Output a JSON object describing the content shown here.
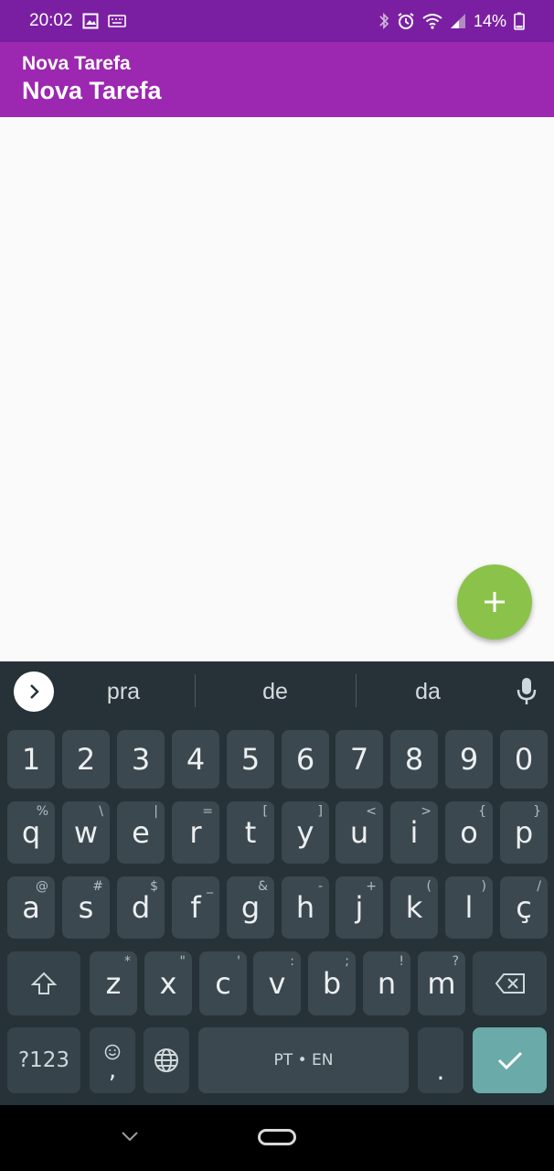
{
  "status_bar": {
    "time": "20:02",
    "battery": "14%",
    "icons": [
      "image-icon",
      "keyboard-icon",
      "bluetooth-icon",
      "alarm-icon",
      "wifi-icon",
      "signal-icon",
      "battery-icon"
    ]
  },
  "app_bar": {
    "subtitle": "Nova Tarefa",
    "title": "Nova Tarefa",
    "color": "#9c27b0"
  },
  "fab": {
    "icon": "plus-icon",
    "color": "#8bc34a"
  },
  "keyboard": {
    "suggestions": [
      "pra",
      "de",
      "da"
    ],
    "number_row": [
      "1",
      "2",
      "3",
      "4",
      "5",
      "6",
      "7",
      "8",
      "9",
      "0"
    ],
    "row1": [
      {
        "key": "q",
        "hint": "%"
      },
      {
        "key": "w",
        "hint": "\\"
      },
      {
        "key": "e",
        "hint": "|"
      },
      {
        "key": "r",
        "hint": "="
      },
      {
        "key": "t",
        "hint": "["
      },
      {
        "key": "y",
        "hint": "]"
      },
      {
        "key": "u",
        "hint": "<"
      },
      {
        "key": "i",
        "hint": ">"
      },
      {
        "key": "o",
        "hint": "{"
      },
      {
        "key": "p",
        "hint": "}"
      }
    ],
    "row2": [
      {
        "key": "a",
        "hint": "@"
      },
      {
        "key": "s",
        "hint": "#"
      },
      {
        "key": "d",
        "hint": "$"
      },
      {
        "key": "f",
        "hint": "_"
      },
      {
        "key": "g",
        "hint": "&"
      },
      {
        "key": "h",
        "hint": "-"
      },
      {
        "key": "j",
        "hint": "+"
      },
      {
        "key": "k",
        "hint": "("
      },
      {
        "key": "l",
        "hint": ")"
      },
      {
        "key": "ç",
        "hint": "/"
      }
    ],
    "row3": [
      {
        "key": "z",
        "hint": "*"
      },
      {
        "key": "x",
        "hint": "\""
      },
      {
        "key": "c",
        "hint": "'"
      },
      {
        "key": "v",
        "hint": ":"
      },
      {
        "key": "b",
        "hint": ";"
      },
      {
        "key": "n",
        "hint": "!"
      },
      {
        "key": "m",
        "hint": "?"
      }
    ],
    "symbols_label": "?123",
    "comma_label": ",",
    "space_label": "PT • EN",
    "period_label": ".",
    "enter_color": "#6aaaa8"
  }
}
